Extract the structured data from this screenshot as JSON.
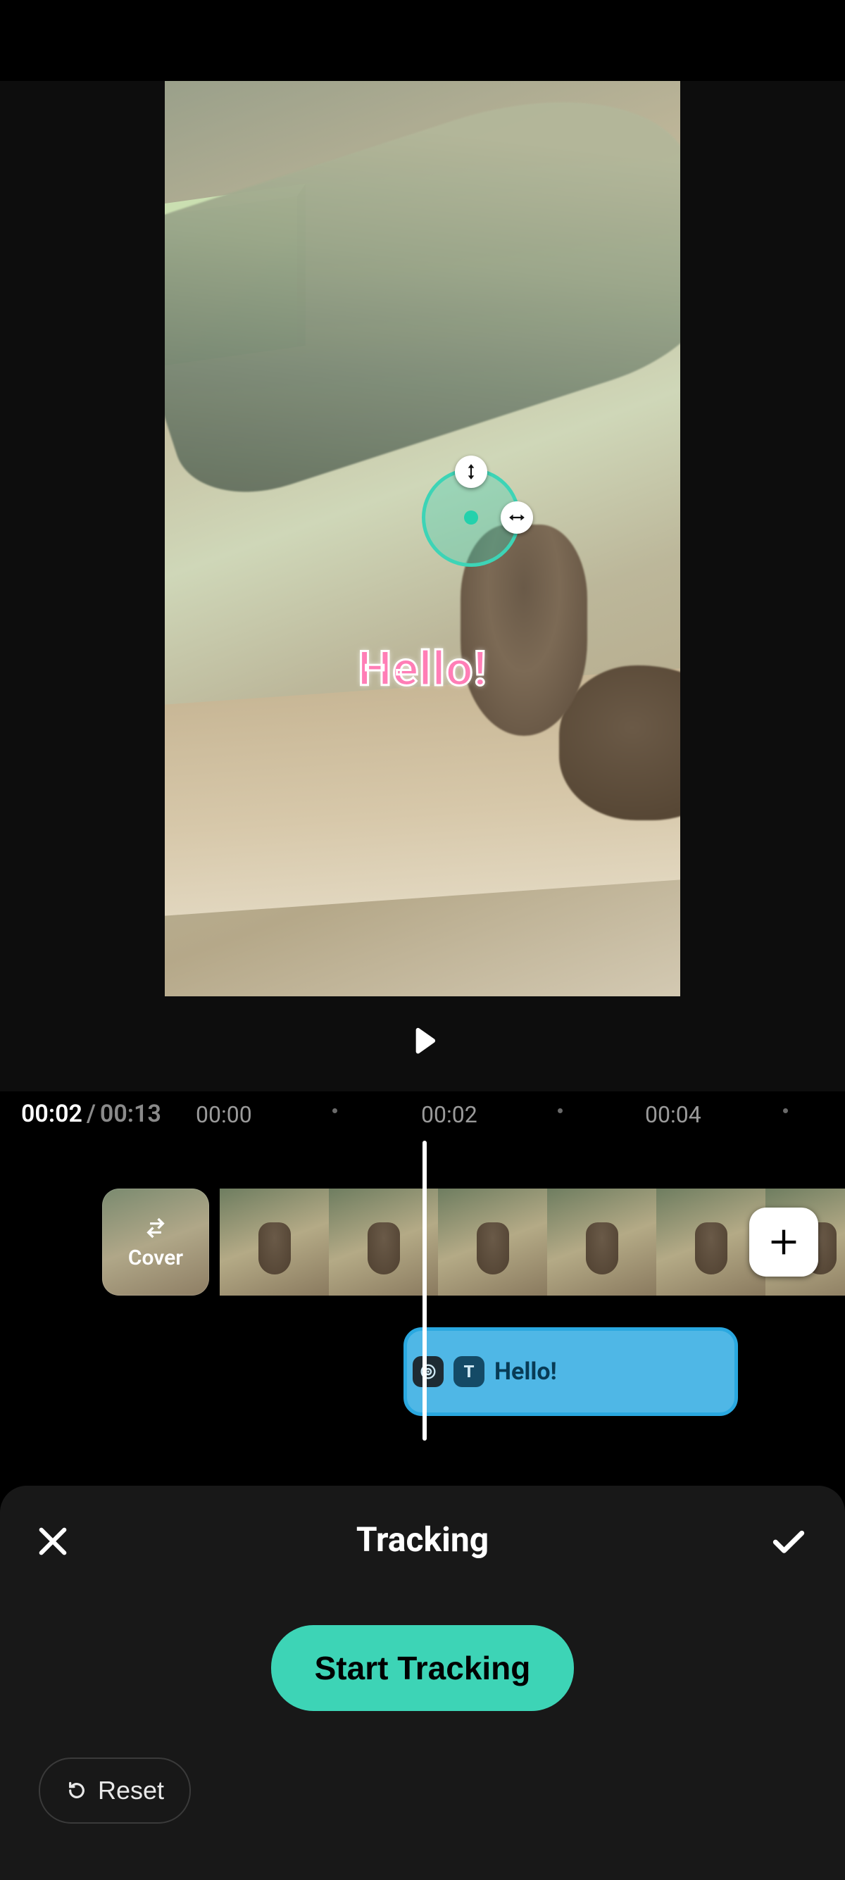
{
  "preview": {
    "overlay_text": "Hello!",
    "tracker": {
      "visible": true
    }
  },
  "playback": {
    "current": "00:02",
    "duration": "00:13",
    "ticks": [
      "00:00",
      "00:02",
      "00:04"
    ]
  },
  "timeline": {
    "cover_label": "Cover",
    "text_clip_label": "Hello!"
  },
  "sheet": {
    "title": "Tracking",
    "start_label": "Start Tracking",
    "reset_label": "Reset"
  },
  "colors": {
    "accent": "#3dd4b6",
    "text_clip": "#4fb7e6",
    "overlay_text": "#ff7eb6"
  }
}
